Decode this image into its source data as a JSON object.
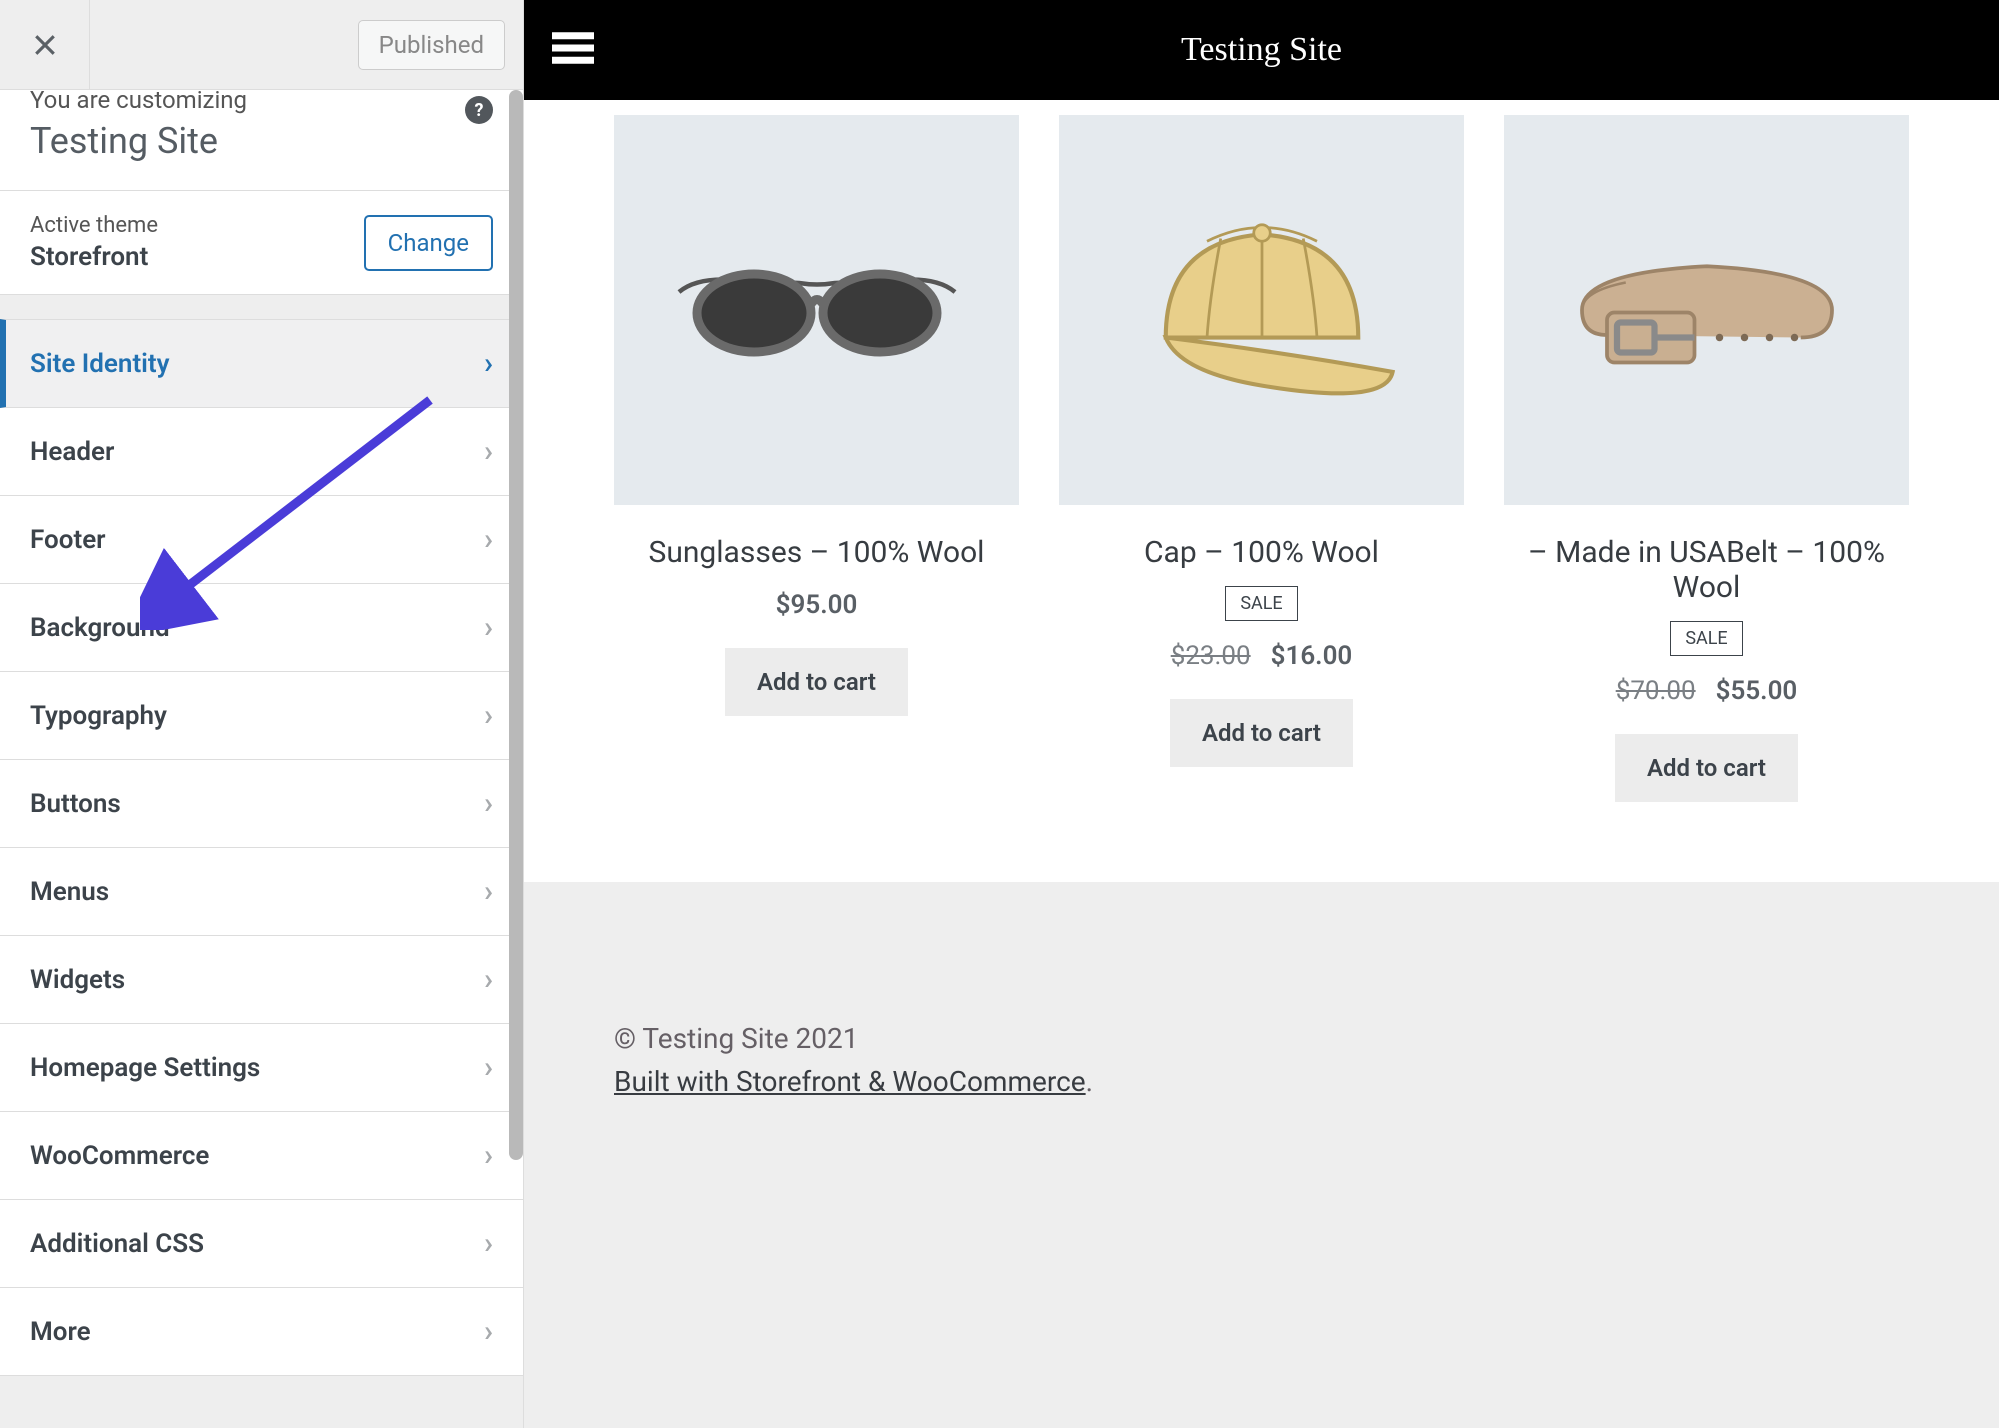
{
  "topbar": {
    "publish_label": "Published"
  },
  "panel": {
    "pretitle": "You are customizing",
    "title": "Testing Site"
  },
  "theme": {
    "label": "Active theme",
    "name": "Storefront",
    "change_label": "Change"
  },
  "sections": [
    {
      "key": "site-identity",
      "label": "Site Identity",
      "active": true
    },
    {
      "key": "header",
      "label": "Header"
    },
    {
      "key": "footer",
      "label": "Footer"
    },
    {
      "key": "background",
      "label": "Background"
    },
    {
      "key": "typography",
      "label": "Typography"
    },
    {
      "key": "buttons",
      "label": "Buttons"
    },
    {
      "key": "menus",
      "label": "Menus"
    },
    {
      "key": "widgets",
      "label": "Widgets"
    },
    {
      "key": "homepage-settings",
      "label": "Homepage Settings"
    },
    {
      "key": "woocommerce",
      "label": "WooCommerce"
    },
    {
      "key": "additional-css",
      "label": "Additional CSS"
    },
    {
      "key": "more",
      "label": "More"
    }
  ],
  "site": {
    "title": "Testing Site"
  },
  "products": [
    {
      "title": "Sunglasses – 100% Wool",
      "price": "$95.00",
      "sale": false,
      "button": "Add to cart",
      "image": "sunglasses"
    },
    {
      "title": "Cap – 100% Wool",
      "sale": true,
      "sale_label": "SALE",
      "old_price": "$23.00",
      "price": "$16.00",
      "button": "Add to cart",
      "image": "cap"
    },
    {
      "title": "– Made in USABelt – 100% Wool",
      "sale": true,
      "sale_label": "SALE",
      "old_price": "$70.00",
      "price": "$55.00",
      "button": "Add to cart",
      "image": "belt"
    }
  ],
  "footer": {
    "copyright": "© Testing Site 2021",
    "credit": "Built with Storefront & WooCommerce",
    "period": "."
  }
}
